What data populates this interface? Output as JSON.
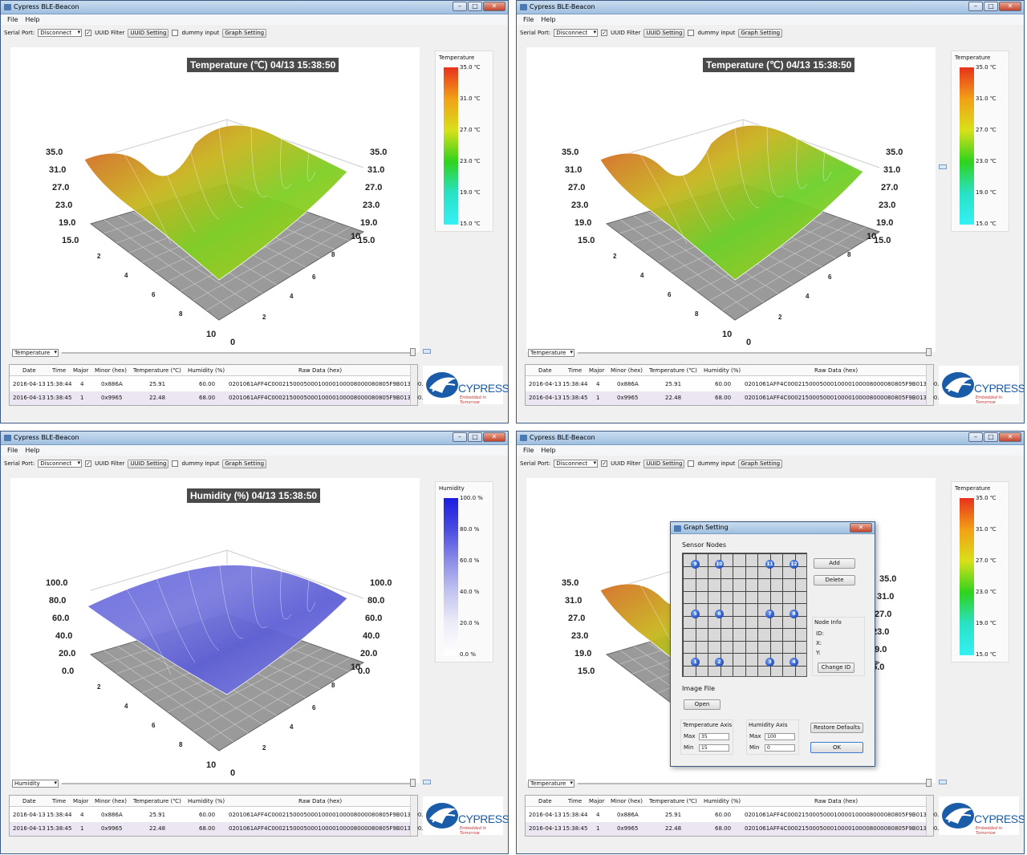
{
  "app": {
    "title": "Cypress BLE-Beacon",
    "menu": [
      "File",
      "Help"
    ]
  },
  "toolbar": {
    "serial_port_label": "Serial Port:",
    "serial_port_value": "Disconnect",
    "uuid_filter_label": "UUID Filter",
    "uuid_filter_checked": true,
    "uuid_setting_button": "UUID Setting",
    "dummy_input_label": "dummy input",
    "dummy_input_checked": false,
    "graph_setting_button": "Graph Setting"
  },
  "table": {
    "headers": [
      "Date",
      "Time",
      "Major",
      "Minor (hex)",
      "Temperature (℃)",
      "Humidity (%)",
      "Raw Data (hex)"
    ],
    "rows": [
      [
        "2016-04-13",
        "15:38:44",
        "4",
        "0x886A",
        "25.91",
        "60.00",
        "0201061AFF4C000215000500010000100008000080805F9B013100..."
      ],
      [
        "2016-04-13",
        "15:38:45",
        "1",
        "0x9965",
        "22.48",
        "68.00",
        "0201061AFF4C000215000500010000100008000080805F9B013100..."
      ]
    ]
  },
  "logo": {
    "text": "CYPRESS",
    "tagline": "Embedded in Tomorrow"
  },
  "panels": [
    {
      "mode": "Temperature",
      "title": "Temperature (℃)  04/13 15:38:50",
      "legend_title": "Temperature",
      "legend_ticks": [
        "35.0 ℃",
        "31.0 ℃",
        "27.0 ℃",
        "23.0 ℃",
        "19.0 ℃",
        "15.0 ℃"
      ],
      "gradient": [
        "#e8311c",
        "#f2a016",
        "#d9e01a",
        "#2fd31c",
        "#29e2c5",
        "#35f0f5"
      ],
      "z_labels": [
        "35.0",
        "31.0",
        "27.0",
        "23.0",
        "19.0",
        "15.0"
      ],
      "x_labels": [
        "2",
        "4",
        "6",
        "8",
        "10"
      ],
      "y_labels": [
        "10",
        "8",
        "6",
        "4",
        "2",
        "0"
      ],
      "surface": [
        "#d9582a",
        "#c9b51e",
        "#7ecf24",
        "#b8c91c"
      ]
    },
    {
      "mode": "Temperature",
      "title": "Temperature (℃)  04/13 15:38:50",
      "legend_title": "Temperature",
      "legend_ticks": [
        "35.0 ℃",
        "31.0 ℃",
        "27.0 ℃",
        "23.0 ℃",
        "19.0 ℃",
        "15.0 ℃"
      ],
      "gradient": [
        "#e8311c",
        "#f2a016",
        "#d9e01a",
        "#2fd31c",
        "#29e2c5",
        "#35f0f5"
      ],
      "z_labels": [
        "35.0",
        "31.0",
        "27.0",
        "23.0",
        "19.0",
        "15.0"
      ],
      "x_labels": [
        "2",
        "4",
        "6",
        "8",
        "10"
      ],
      "y_labels": [
        "10",
        "8",
        "6",
        "4",
        "2",
        "0"
      ],
      "surface": [
        "#d9582a",
        "#c9b51e",
        "#6cd02a",
        "#b8c91c"
      ]
    },
    {
      "mode": "Humidity",
      "title": "Humidity (%)  04/13 15:38:50",
      "legend_title": "Humidity",
      "legend_ticks": [
        "100.0 %",
        "80.0 %",
        "60.0 %",
        "40.0 %",
        "20.0 %",
        "0.0 %"
      ],
      "gradient": [
        "#1c1ce0",
        "#4a4ce0",
        "#8b8de8",
        "#c4c5f0",
        "#ededf8",
        "#ffffff"
      ],
      "z_labels": [
        "100.0",
        "80.0",
        "60.0",
        "40.0",
        "20.0",
        "0.0"
      ],
      "x_labels": [
        "2",
        "4",
        "6",
        "8",
        "10"
      ],
      "y_labels": [
        "10",
        "8",
        "6",
        "4",
        "2",
        "0"
      ],
      "surface": [
        "#6a6ae0",
        "#7a7bde",
        "#5f60d6",
        "#8486e4"
      ]
    },
    {
      "mode": "Temperature",
      "title": "",
      "legend_title": "Temperature",
      "legend_ticks": [
        "35.0 ℃",
        "31.0 ℃",
        "27.0 ℃",
        "23.0 ℃",
        "19.0 ℃",
        "15.0 ℃"
      ],
      "gradient": [
        "#e8311c",
        "#f2a016",
        "#d9e01a",
        "#2fd31c",
        "#29e2c5",
        "#35f0f5"
      ],
      "z_labels": [
        "35.0",
        "31.0",
        "27.0",
        "23.0",
        "19.0",
        "15.0"
      ],
      "x_labels": [],
      "y_labels": [],
      "surface": [
        "#d9582a",
        "#c9b51e",
        "#7ecf24",
        "#b8c91c"
      ]
    }
  ],
  "dialog": {
    "title": "Graph Setting",
    "sensor_nodes_label": "Sensor Nodes",
    "add_button": "Add",
    "delete_button": "Delete",
    "node_info_label": "Node Info",
    "id_label": "ID:",
    "x_label": "X:",
    "y_label": "Y:",
    "change_id_button": "Change ID",
    "image_file_label": "Image File",
    "open_button": "Open",
    "temp_axis_label": "Temperature Axis",
    "humidity_axis_label": "Humidity Axis",
    "max_label": "Max",
    "min_label": "Min",
    "temp_max": "35",
    "temp_min": "15",
    "hum_max": "100",
    "hum_min": "0",
    "restore_button": "Restore Defaults",
    "ok_button": "OK",
    "nodes": [
      "9",
      "10",
      "11",
      "12",
      "5",
      "6",
      "7",
      "8",
      "1",
      "2",
      "3",
      "4"
    ]
  }
}
